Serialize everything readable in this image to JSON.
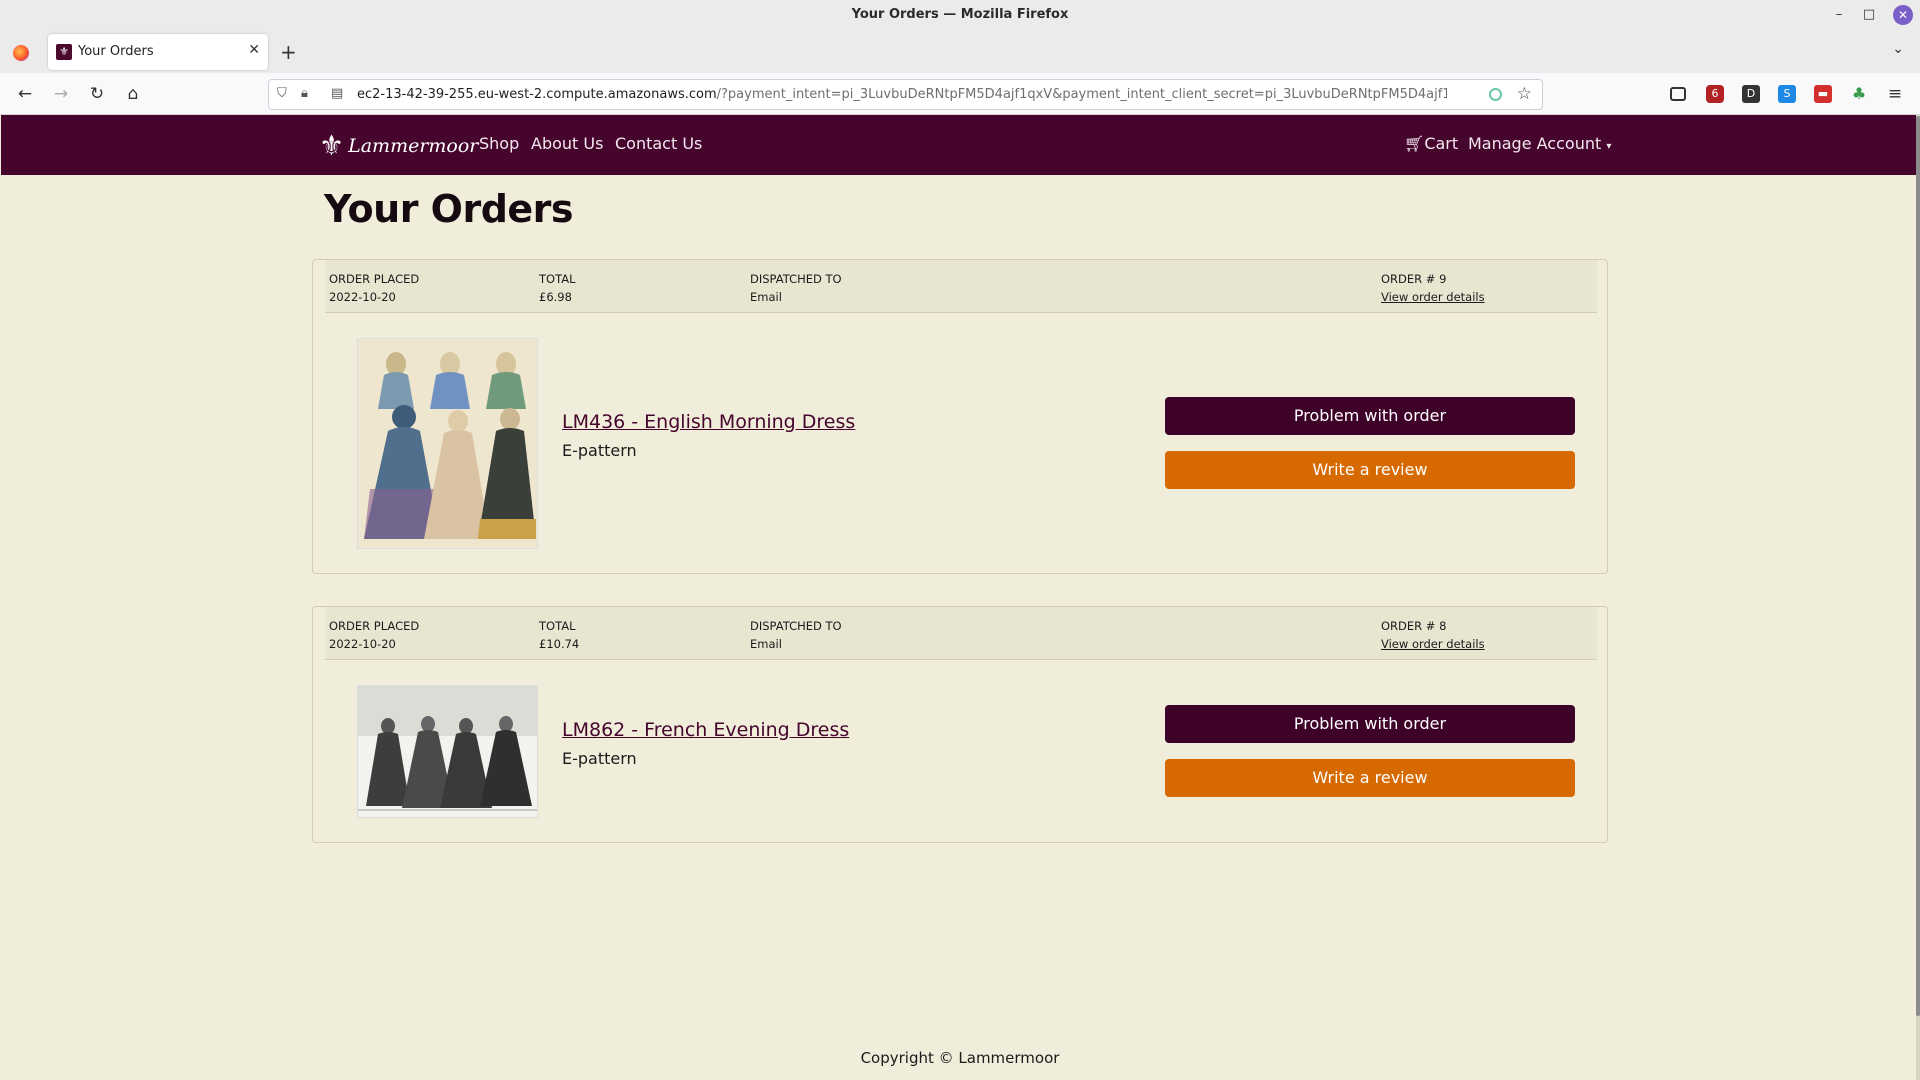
{
  "window": {
    "title": "Your Orders — Mozilla Firefox"
  },
  "browser": {
    "tab_title": "Your Orders",
    "url_host": "ec2-13-42-39-255.eu-west-2.compute.amazonaws.com",
    "url_rest": "/?payment_intent=pi_3LuvbuDeRNtpFM5D4ajf1qxV&payment_intent_client_secret=pi_3LuvbuDeRNtpFM5D4ajf1qxV_secr",
    "ext_badge": "6"
  },
  "site": {
    "brand": "Lammermoor",
    "nav": {
      "shop": "Shop",
      "about": "About Us",
      "contact": "Contact Us",
      "cart": "Cart",
      "manage": "Manage Account"
    },
    "accent_color": "#46052d",
    "review_color": "#d66a00"
  },
  "page": {
    "title": "Your Orders"
  },
  "labels": {
    "order_placed": "ORDER PLACED",
    "total": "TOTAL",
    "dispatched_to": "DISPATCHED TO",
    "view_details": "View order details",
    "problem": "Problem with order",
    "review": "Write a review"
  },
  "orders": [
    {
      "order_number": "ORDER # 9",
      "date": "2022-10-20",
      "total": "£6.98",
      "dispatched_to": "Email",
      "product_name": "LM436 - English Morning Dress",
      "product_type": "E-pattern"
    },
    {
      "order_number": "ORDER # 8",
      "date": "2022-10-20",
      "total": "£10.74",
      "dispatched_to": "Email",
      "product_name": "LM862 - French Evening Dress",
      "product_type": "E-pattern"
    }
  ],
  "footer": {
    "copyright": "Copyright © Lammermoor"
  }
}
